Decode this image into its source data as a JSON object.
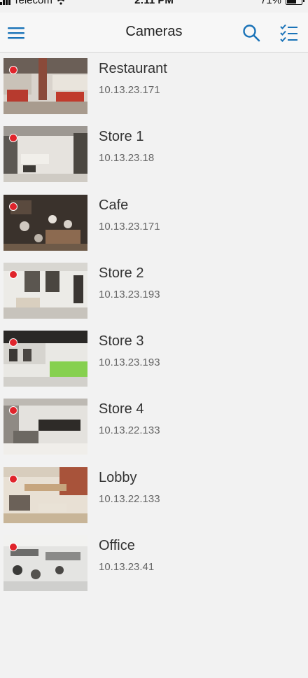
{
  "status_bar": {
    "carrier": "Telecom",
    "time": "2:11 PM",
    "battery_percent": "71%",
    "battery_level": 0.71,
    "signal_icon": "signal-bars-icon",
    "wifi_icon": "wifi-icon"
  },
  "nav": {
    "title": "Cameras",
    "menu_icon": "hamburger-menu-icon",
    "search_icon": "search-icon",
    "select_icon": "checklist-icon",
    "accent_color": "#1a73b8"
  },
  "recording_color": "#e0242b",
  "cameras": [
    {
      "name": "Restaurant",
      "ip": "10.13.23.171",
      "thumbnail": "restaurant-interior"
    },
    {
      "name": "Store 1",
      "ip": "10.13.23.18",
      "thumbnail": "store-interior"
    },
    {
      "name": "Cafe",
      "ip": "10.13.23.171",
      "thumbnail": "cafe-overhead"
    },
    {
      "name": "Store 2",
      "ip": "10.13.23.193",
      "thumbnail": "clothing-store"
    },
    {
      "name": "Store 3",
      "ip": "10.13.23.193",
      "thumbnail": "store-green-counter"
    },
    {
      "name": "Store 4",
      "ip": "10.13.22.133",
      "thumbnail": "marble-store"
    },
    {
      "name": "Lobby",
      "ip": "10.13.22.133",
      "thumbnail": "lobby-lounge"
    },
    {
      "name": "Office",
      "ip": "10.13.23.41",
      "thumbnail": "open-office"
    }
  ]
}
